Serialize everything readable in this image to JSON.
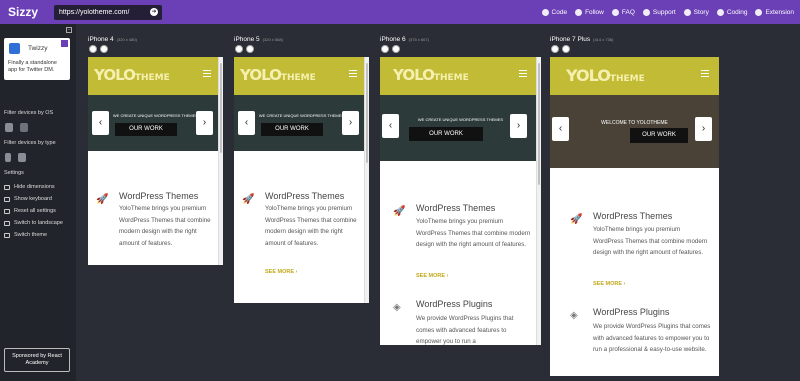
{
  "app": {
    "title": "Sizzy",
    "url_value": "https://yolotheme.com/"
  },
  "topnav": [
    {
      "label": "Code",
      "icon": "github-icon"
    },
    {
      "label": "Follow",
      "icon": "twitter-icon"
    },
    {
      "label": "FAQ",
      "icon": "question-icon"
    },
    {
      "label": "Support",
      "icon": "chat-icon"
    },
    {
      "label": "Story",
      "icon": "book-icon"
    },
    {
      "label": "Coding",
      "icon": "video-icon"
    },
    {
      "label": "Extension",
      "icon": "chrome-icon"
    }
  ],
  "sidebar": {
    "ad": {
      "title": "Twizzy",
      "text": "Finally a standalone app for Twitter DM."
    },
    "filter_os_label": "Filter devices by OS",
    "filter_type_label": "Filter devices by type",
    "settings_label": "Settings",
    "settings": [
      "Hide dimensions",
      "Show keyboard",
      "Reset all settings",
      "Switch to landscape",
      "Switch theme"
    ],
    "sponsor": "Sponsored by React Academy"
  },
  "devices": [
    {
      "name": "iPhone 4",
      "size": "(320 x 480)"
    },
    {
      "name": "iPhone 5",
      "size": "(320 x 568)"
    },
    {
      "name": "iPhone 6",
      "size": "(375 x 667)"
    },
    {
      "name": "iPhone 7 Plus",
      "size": "(414 x 736)"
    }
  ],
  "site": {
    "logo_main": "YOLO",
    "logo_sub": "THEME",
    "hero_caption": "WE CREATE UNIQUE WORDPRESS THEMES",
    "hero_caption_plus": "WELCOME TO YOLOTHEME",
    "our_work": "OUR WORK",
    "themes_title": "WordPress Themes",
    "themes_text": "YoloTheme brings you premium WordPress Themes that combine modern design with the right amount of features.",
    "see_more": "SEE MORE ›",
    "plugins_title": "WordPress Plugins",
    "plugins_text_6": "We provide WordPress Plugins that comes with advanced features to empower you to run a",
    "plugins_text_7": "We provide WordPress Plugins that comes with advanced features to empower you to run a professional & easy-to-use website."
  },
  "colors": {
    "brand_purple": "#6b3fb5",
    "yolo_olive": "#c2bb35",
    "see_more_gold": "#c2a81c",
    "background": "#2a2d35"
  }
}
